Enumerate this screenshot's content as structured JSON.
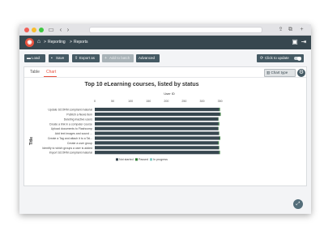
{
  "breadcrumb": {
    "item1": "Reporting",
    "sep": ">",
    "item2": "Reports"
  },
  "toolbar": {
    "load": "Load",
    "save": "Save",
    "export": "Export as",
    "add_to_batch": "Add to batch",
    "advanced": "Advanced",
    "click_to_update": "Click to update"
  },
  "tabs": {
    "table": "Table",
    "chart": "Chart"
  },
  "chart_type_label": "Chart type",
  "colors": {
    "accent": "#e8523f",
    "appbar": "#37474f",
    "button": "#455a64",
    "not_started": "#37474f",
    "passed": "#2e7d32",
    "in_progress": "#80cbc4"
  },
  "icons": [
    "home-icon",
    "chat-icon",
    "logout-icon",
    "folder-icon",
    "save-icon",
    "export-icon",
    "add-icon",
    "chart-icon",
    "gear-icon",
    "expand-icon"
  ],
  "chart_data": {
    "type": "bar",
    "orientation": "horizontal",
    "stacked": true,
    "title": "Top 10 eLearning courses, listed by status",
    "xlabel": "User ID",
    "ylabel": "Title",
    "xlim": [
      0,
      360
    ],
    "xticks": [
      "0",
      "50",
      "100",
      "150",
      "200",
      "250",
      "300",
      "350"
    ],
    "categories": [
      "Update SCORM compliant material",
      "Publish a News item",
      "Deleting inactive users",
      "Create a link in a computer course",
      "Upload documents to Flashcomp",
      "Add text images and sound ...",
      "Create a Tag and attach it to a Tal...",
      "Create a user group",
      "Identify to which groups a user is added",
      "Import SCORM compliant material"
    ],
    "series": [
      {
        "name": "Not started",
        "values": [
          348,
          350,
          345,
          346,
          345,
          347,
          349,
          345,
          347,
          348
        ]
      },
      {
        "name": "Passed",
        "values": [
          2,
          2,
          1,
          2,
          1,
          1,
          2,
          2,
          1,
          2
        ]
      },
      {
        "name": "In progress",
        "values": [
          0,
          0,
          0,
          0,
          0,
          0,
          0,
          0,
          0,
          0
        ]
      }
    ],
    "legend": "bottom",
    "grid": false
  }
}
